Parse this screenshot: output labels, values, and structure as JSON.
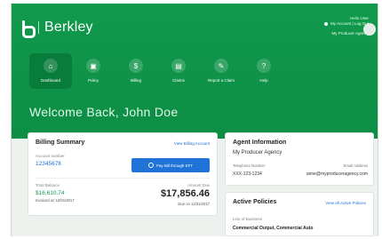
{
  "app": {
    "brand_name": "Berkley",
    "colors": {
      "primary_green": "#0f994c",
      "accent_blue": "#1f73d7",
      "card_bg": "#ffffff"
    }
  },
  "account": {
    "line1": "Hello User",
    "line2": "My Account | Log Out",
    "line3": "My Producer Agency"
  },
  "nav": {
    "items": [
      {
        "label": "Dashboard",
        "icon": "home-icon"
      },
      {
        "label": "Policy",
        "icon": "policy-icon"
      },
      {
        "label": "Billing",
        "icon": "billing-icon"
      },
      {
        "label": "Claims",
        "icon": "claims-icon"
      },
      {
        "label": "Report a Claim",
        "icon": "report-icon"
      },
      {
        "label": "Help",
        "icon": "help-icon"
      }
    ]
  },
  "welcome": {
    "text": "Welcome Back, John Doe"
  },
  "billing": {
    "title": "Billing Summary",
    "view_link": "View Billing Account",
    "account_label": "Account number",
    "account_number": "12345678",
    "button_label": "Pay Bill through EFT",
    "balance_label": "Total Balance",
    "balance_value": "$16,610.74",
    "balance_date": "Invoiced on 12/01/2017",
    "amount_label": "Amount Due",
    "amount_value": "$17,856.46",
    "due_date": "Due on 12/31/2017"
  },
  "agent": {
    "title": "Agent Information",
    "agency": "My Producer Agency",
    "phone_label": "Telephone Number",
    "phone": "XXX-123-1234",
    "email_label": "Email Address",
    "email": "anne@myproduceragency.com"
  },
  "policies": {
    "title": "Active Policies",
    "view_link": "View All Active Policies",
    "label": "Line of Business",
    "line": "Commercial Output, Commercial Auto"
  }
}
